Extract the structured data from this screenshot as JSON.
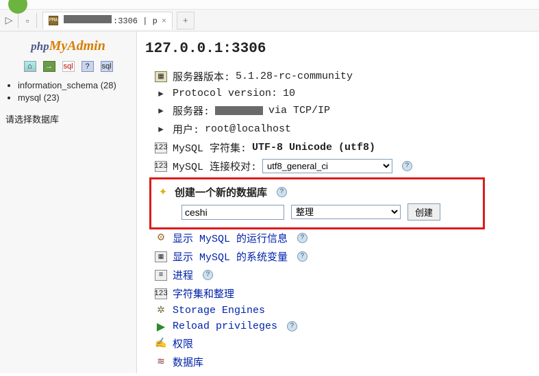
{
  "topstrip": {},
  "tabbar": {
    "host_visible": ":3306 | p",
    "favicon_text": "PMA"
  },
  "sidebar": {
    "logo_php": "php",
    "logo_myadmin": "MyAdmin",
    "databases": [
      {
        "name": "information_schema",
        "count": "(28)"
      },
      {
        "name": "mysql",
        "count": "(23)"
      }
    ],
    "choose_label": "请选择数据库"
  },
  "main": {
    "title": "127.0.0.1:3306",
    "server_version_label": "服务器版本: ",
    "server_version_value": "5.1.28-rc-community",
    "protocol_label": "Protocol version: ",
    "protocol_value": "10",
    "server_label": "服务器: ",
    "server_suffix": " via TCP/IP",
    "user_label": "用户: ",
    "user_value": "root@localhost",
    "charset_label": "MySQL 字符集: ",
    "charset_value": "UTF-8 Unicode (utf8)",
    "collation_label": "MySQL 连接校对: ",
    "collation_value": "utf8_general_ci",
    "create_label": "创建一个新的数据库",
    "create_input_value": "ceshi",
    "create_collation_placeholder": "整理",
    "create_button": "创建",
    "links": {
      "runtime": "显示 MySQL 的运行信息",
      "vars": "显示 MySQL 的系统变量",
      "processes": "进程",
      "charsets": "字符集和整理",
      "engines": "Storage Engines",
      "reload": "Reload privileges",
      "privs": "权限",
      "databases": "数据库"
    }
  }
}
